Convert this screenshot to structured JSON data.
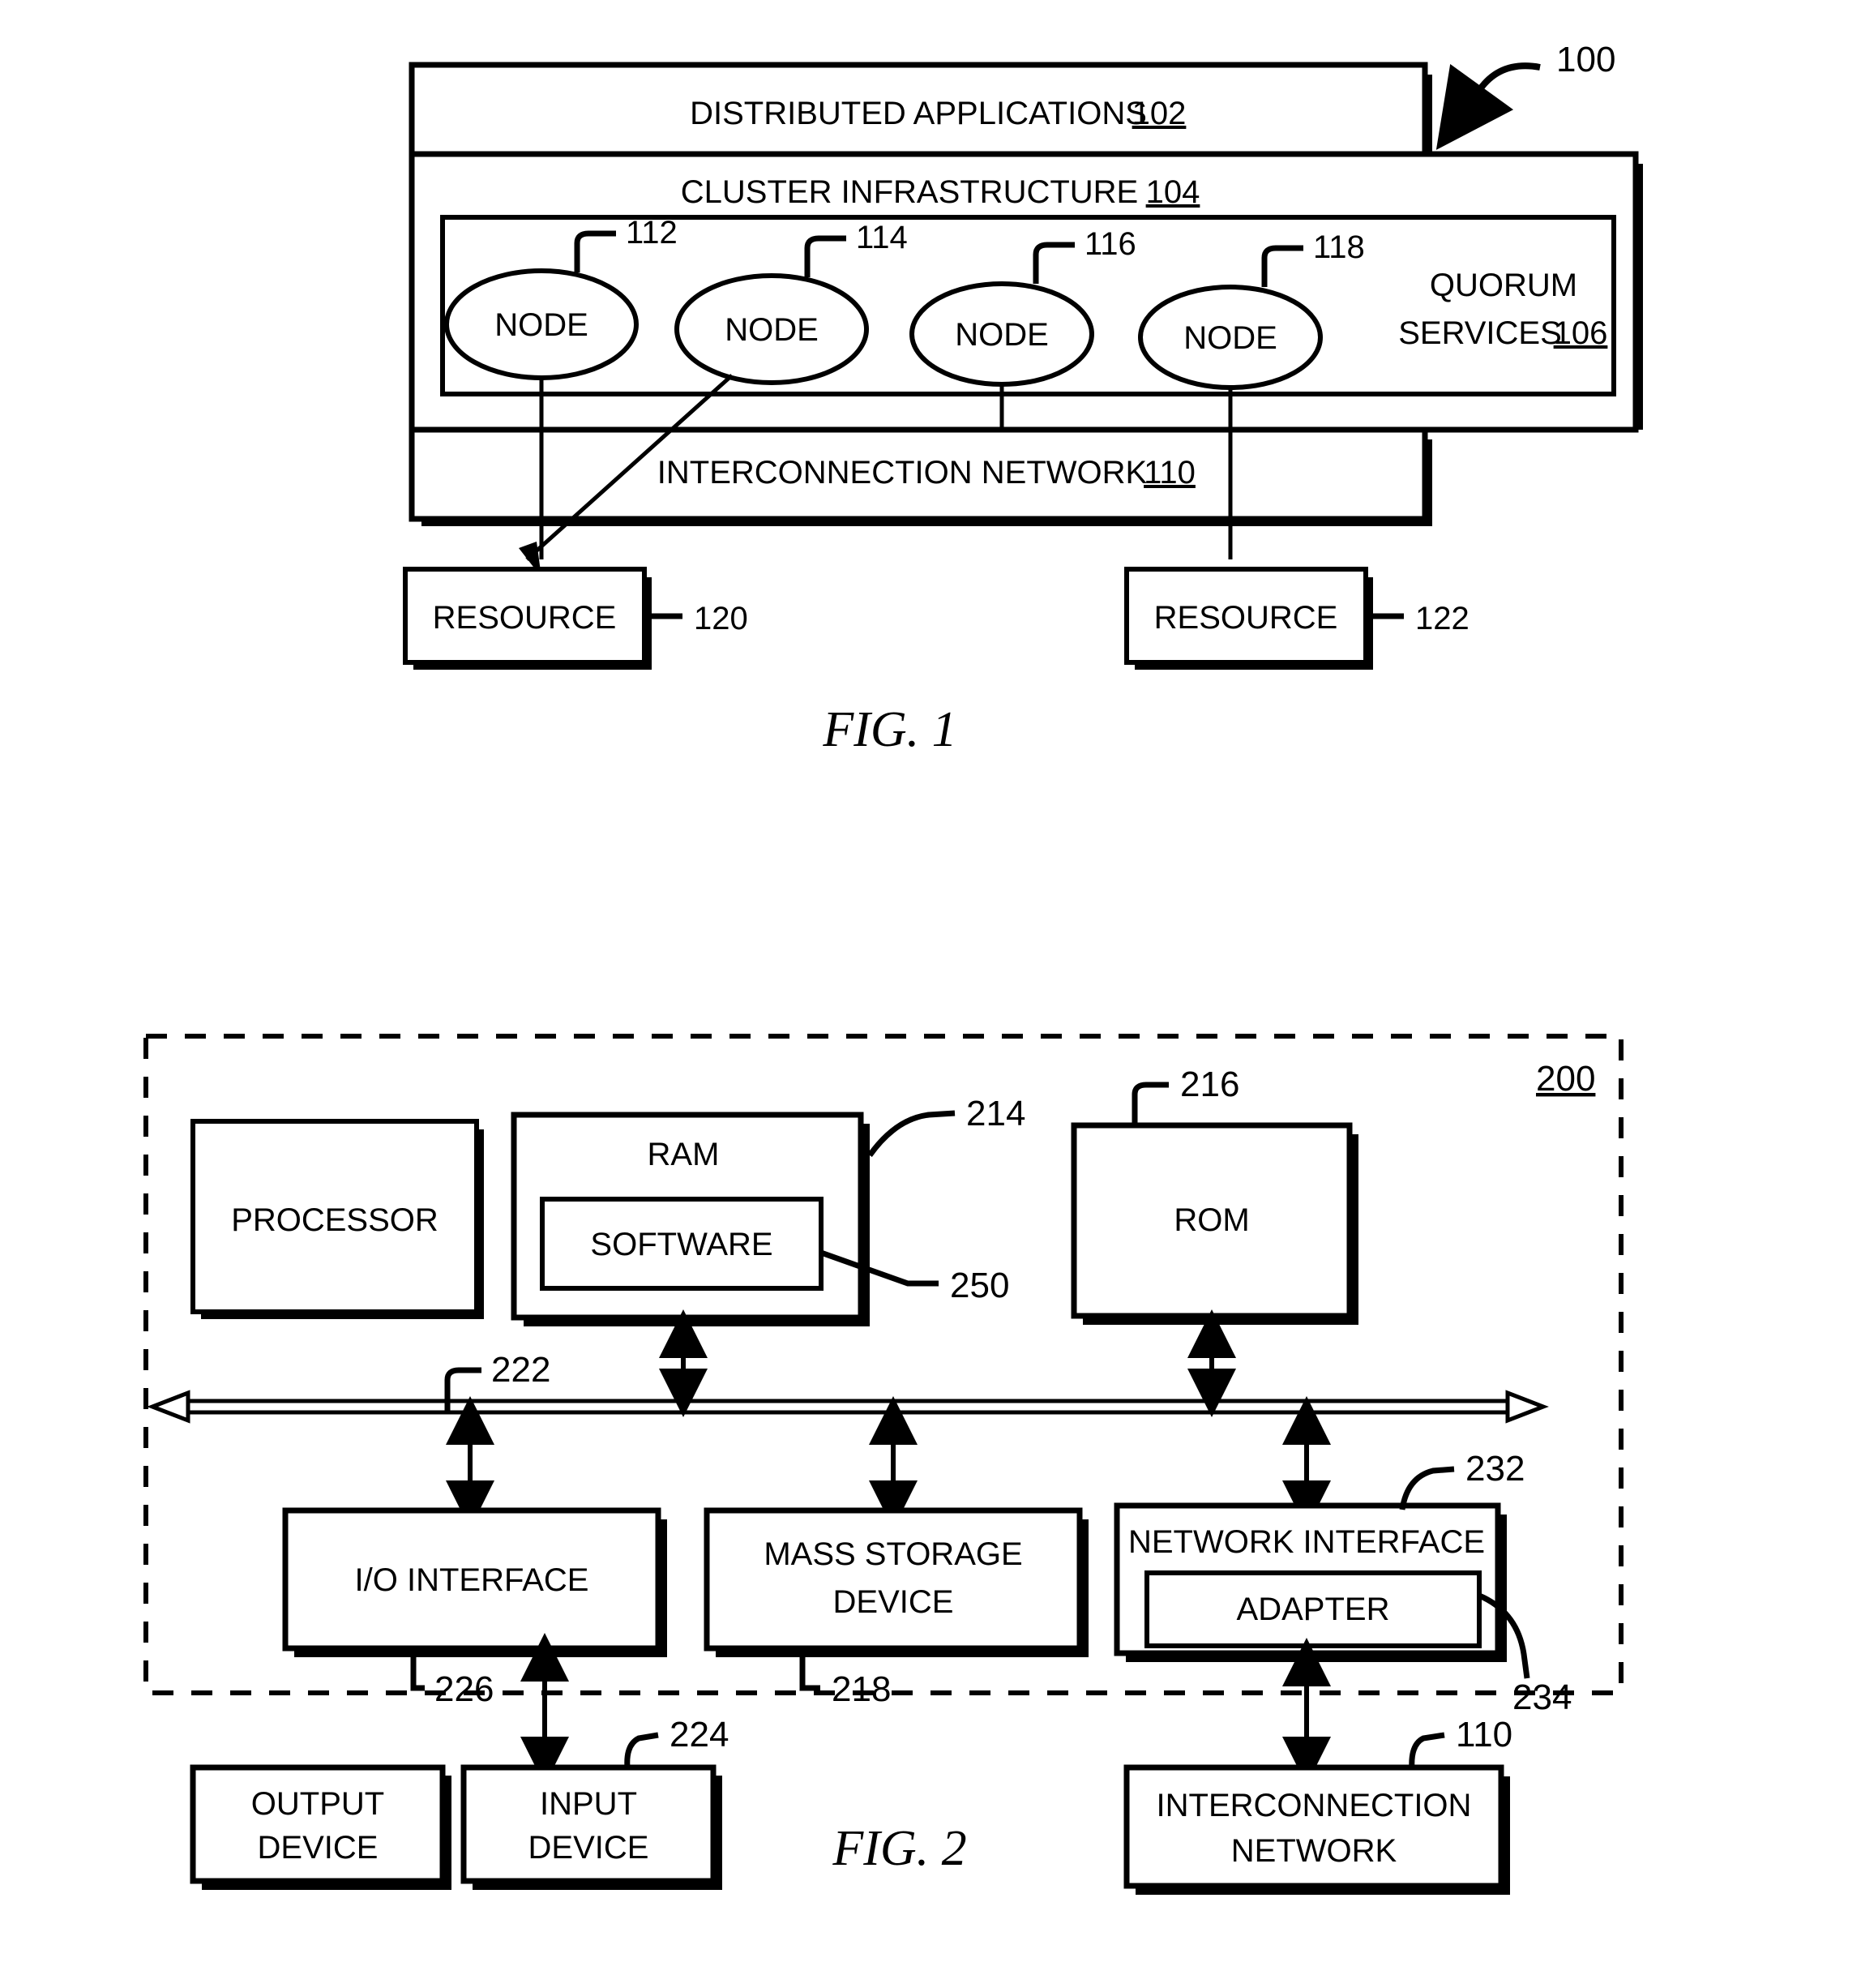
{
  "figure1": {
    "ref_main": "100",
    "caption": "FIG. 1",
    "layers": {
      "distributed_applications": {
        "label": "DISTRIBUTED APPLICATIONS",
        "ref": "102"
      },
      "cluster_infrastructure": {
        "label": "CLUSTER INFRASTRUCTURE",
        "ref": "104"
      },
      "quorum_services": {
        "label_line1": "QUORUM",
        "label_line2": "SERVICES",
        "ref": "106"
      },
      "interconnection_network": {
        "label": "INTERCONNECTION NETWORK",
        "ref": "110"
      }
    },
    "nodes": [
      {
        "label": "NODE",
        "ref": "112"
      },
      {
        "label": "NODE",
        "ref": "114"
      },
      {
        "label": "NODE",
        "ref": "116"
      },
      {
        "label": "NODE",
        "ref": "118"
      }
    ],
    "resources": [
      {
        "label": "RESOURCE",
        "ref": "120"
      },
      {
        "label": "RESOURCE",
        "ref": "122"
      }
    ]
  },
  "figure2": {
    "ref_main": "200",
    "caption": "FIG. 2",
    "components": {
      "processor": {
        "label": "PROCESSOR"
      },
      "ram": {
        "label": "RAM",
        "ref": "214"
      },
      "software": {
        "label": "SOFTWARE",
        "ref": "250"
      },
      "rom": {
        "label": "ROM",
        "ref": "216"
      },
      "bus": {
        "ref": "222"
      },
      "io_interface": {
        "label": "I/O INTERFACE",
        "ref": "226"
      },
      "mass_storage": {
        "label_line1": "MASS STORAGE",
        "label_line2": "DEVICE",
        "ref": "218"
      },
      "network_interface": {
        "label": "NETWORK INTERFACE",
        "ref": "232"
      },
      "adapter": {
        "label": "ADAPTER",
        "ref": "234"
      },
      "output_device": {
        "label_line1": "OUTPUT",
        "label_line2": "DEVICE"
      },
      "input_device": {
        "label_line1": "INPUT",
        "label_line2": "DEVICE",
        "ref": "224"
      },
      "interconnection_network": {
        "label_line1": "INTERCONNECTION",
        "label_line2": "NETWORK",
        "ref": "110"
      }
    }
  }
}
